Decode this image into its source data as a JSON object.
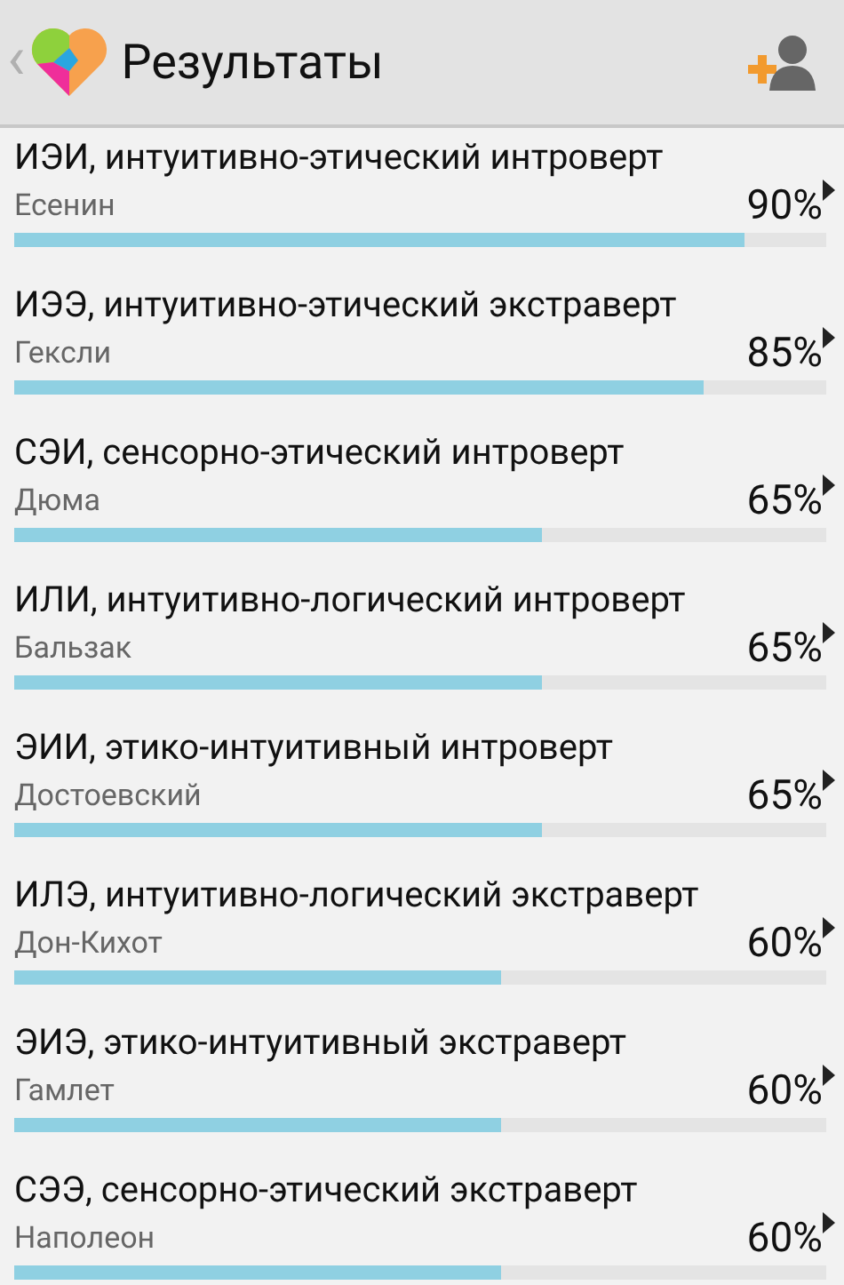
{
  "header": {
    "back": "‹",
    "title": "Результаты"
  },
  "results": [
    {
      "title": "ИЭИ, интуитивно-этический интроверт",
      "person": "Есенин",
      "percent": "90%",
      "level": 0.9
    },
    {
      "title": "ИЭЭ, интуитивно-этический экстраверт",
      "person": "Гексли",
      "percent": "85%",
      "level": 0.85
    },
    {
      "title": "СЭИ, сенсорно-этический интроверт",
      "person": "Дюма",
      "percent": "65%",
      "level": 0.65
    },
    {
      "title": "ИЛИ, интуитивно-логический интроверт",
      "person": "Бальзак",
      "percent": "65%",
      "level": 0.65
    },
    {
      "title": "ЭИИ, этико-интуитивный интроверт",
      "person": "Достоевский",
      "percent": "65%",
      "level": 0.65
    },
    {
      "title": "ИЛЭ, интуитивно-логический экстраверт",
      "person": "Дон-Кихот",
      "percent": "60%",
      "level": 0.6
    },
    {
      "title": "ЭИЭ, этико-интуитивный экстраверт",
      "person": "Гамлет",
      "percent": "60%",
      "level": 0.6
    },
    {
      "title": "СЭЭ, сенсорно-этический экстраверт",
      "person": "Наполеон",
      "percent": "60%",
      "level": 0.6
    }
  ]
}
